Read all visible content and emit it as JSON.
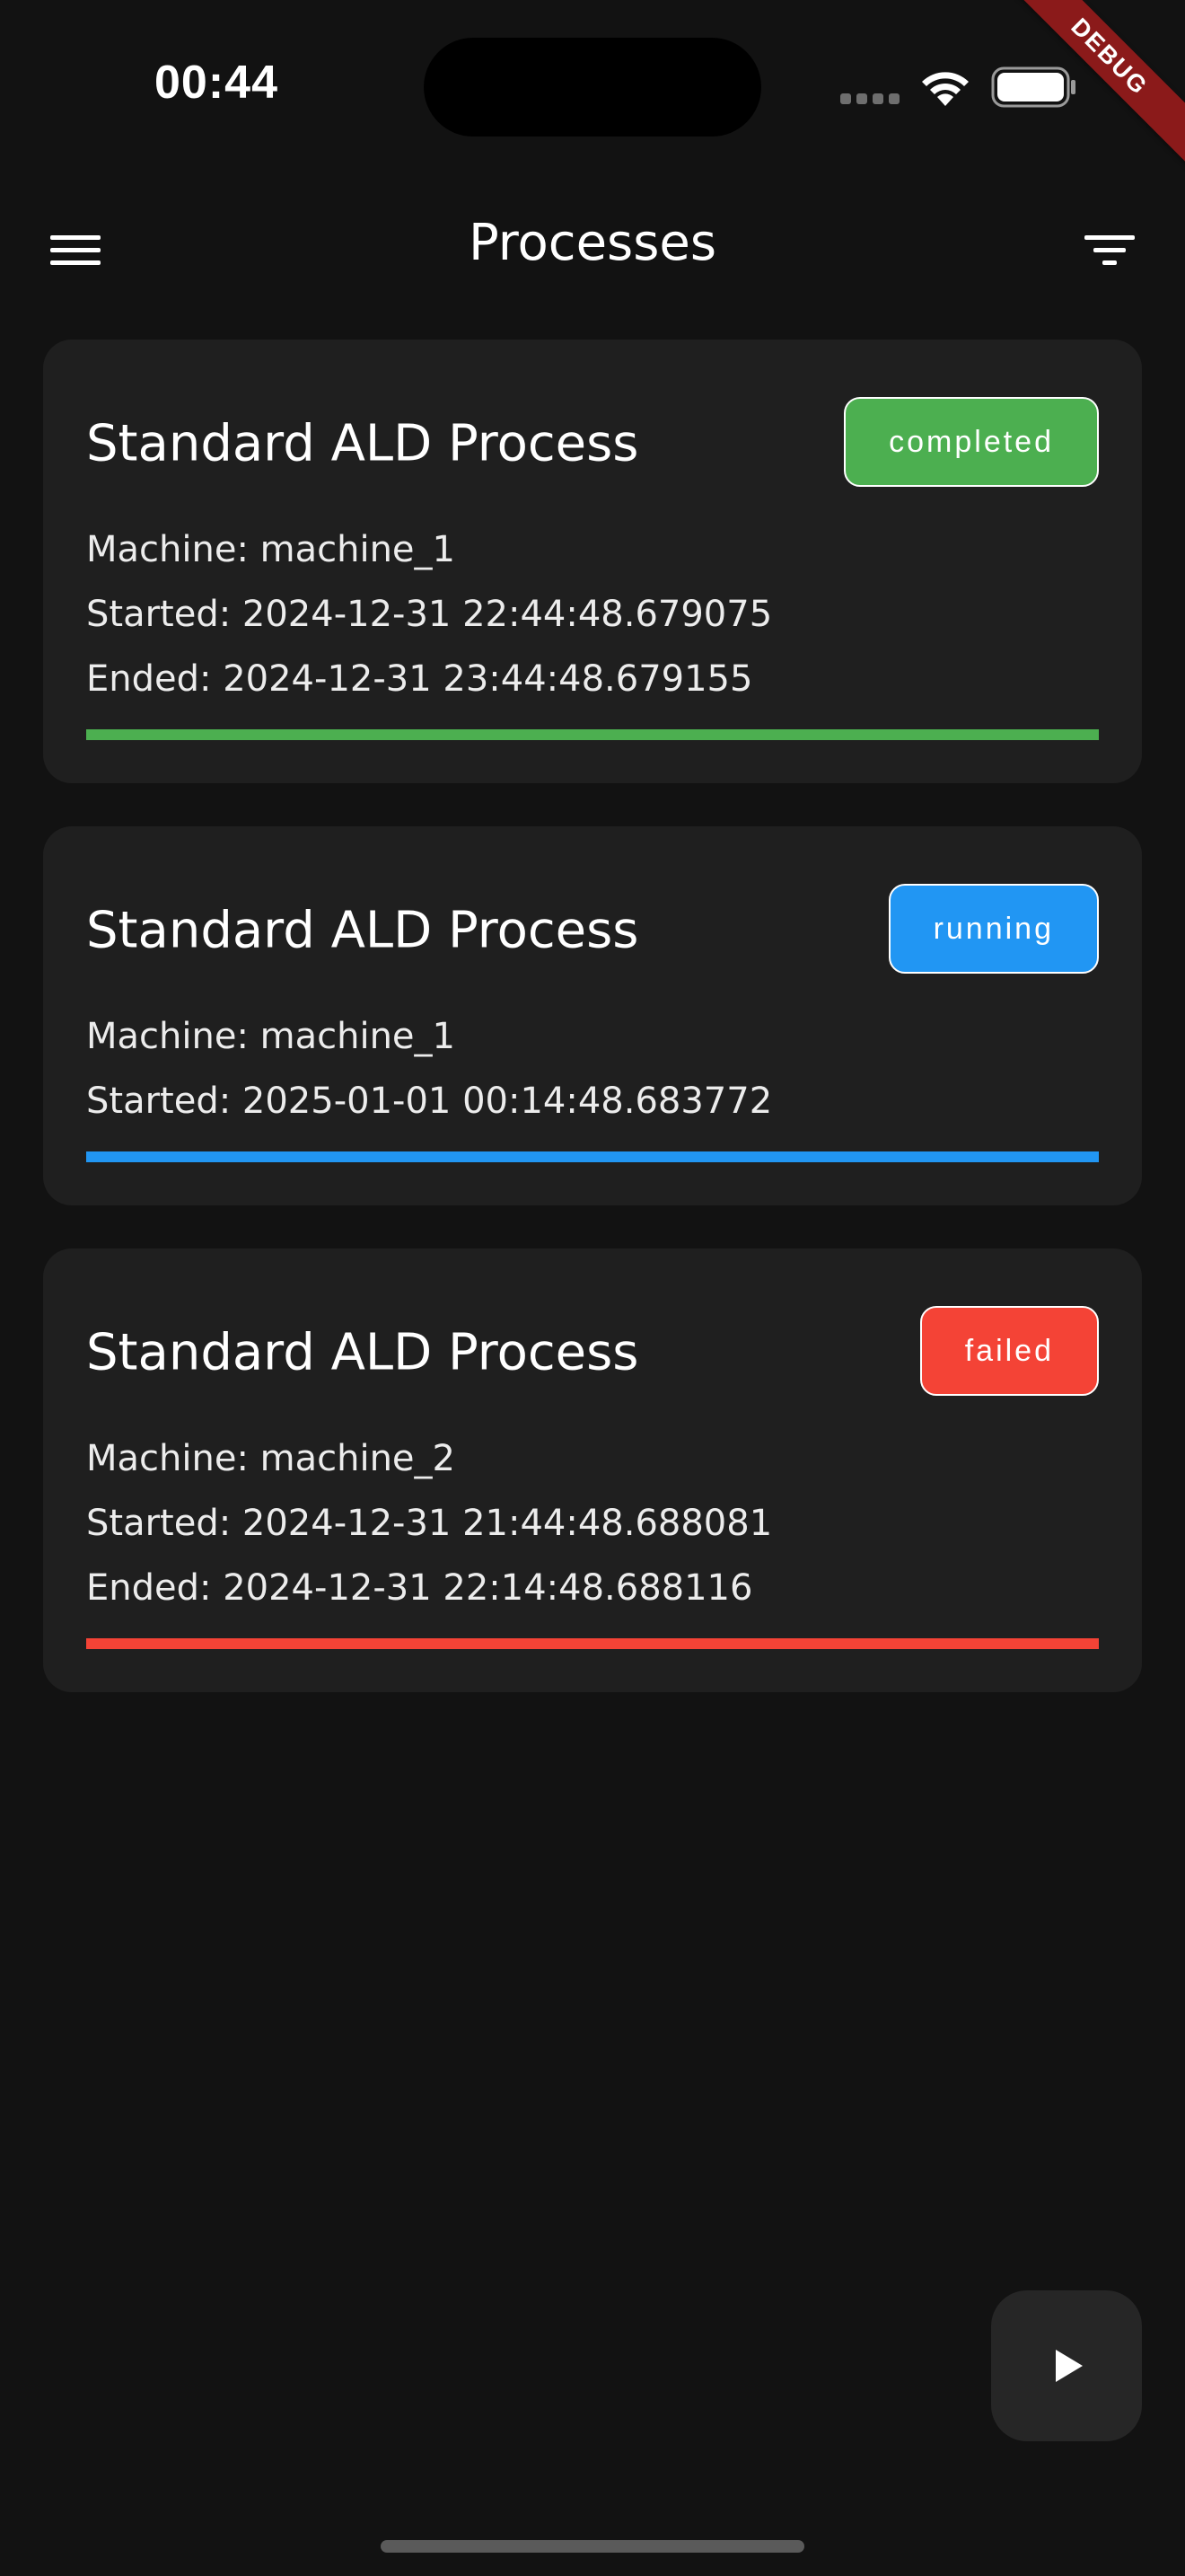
{
  "status_bar": {
    "time": "00:44",
    "icons": [
      "signal-icon",
      "wifi-icon",
      "battery-icon"
    ]
  },
  "debug_banner": "DEBUG",
  "app_bar": {
    "title": "Processes",
    "leading_icon": "menu-icon",
    "trailing_icon": "filter-icon"
  },
  "processes": [
    {
      "name": "Standard ALD Process",
      "status": "completed",
      "status_color": "#4caf50",
      "machine": "Machine: machine_1",
      "started": "Started: 2024-12-31 22:44:48.679075",
      "ended": "Ended: 2024-12-31 23:44:48.679155"
    },
    {
      "name": "Standard ALD Process",
      "status": "running",
      "status_color": "#2196f3",
      "machine": "Machine: machine_1",
      "started": "Started: 2025-01-01 00:14:48.683772"
    },
    {
      "name": "Standard ALD Process",
      "status": "failed",
      "status_color": "#f44336",
      "machine": "Machine: machine_2",
      "started": "Started: 2024-12-31 21:44:48.688081",
      "ended": "Ended: 2024-12-31 22:14:48.688116"
    }
  ],
  "fab": {
    "icon": "play-icon"
  },
  "colors": {
    "background": "#121212",
    "card": "#1f1f1f",
    "completed": "#4caf50",
    "running": "#2196f3",
    "failed": "#f44336"
  }
}
